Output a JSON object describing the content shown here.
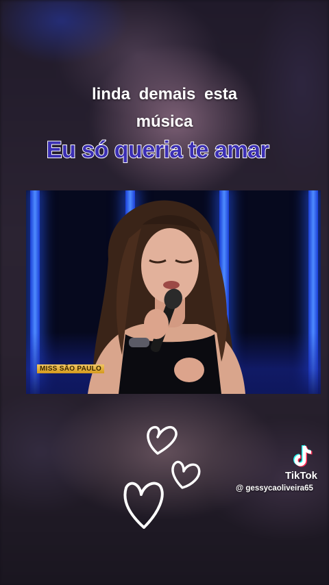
{
  "overlay": {
    "line1": "linda  demais  esta",
    "line2": "música",
    "lyric": "Eu só queria te amar"
  },
  "video": {
    "tag": "MISS SÃO PAULO"
  },
  "watermark": {
    "app": "TikTok",
    "handle": "@ gessycaoliveira65",
    "icon": "tiktok-logo-icon"
  },
  "colors": {
    "lyric_fill": "#3b2fb3",
    "stage_blue": "#2f5cff"
  }
}
